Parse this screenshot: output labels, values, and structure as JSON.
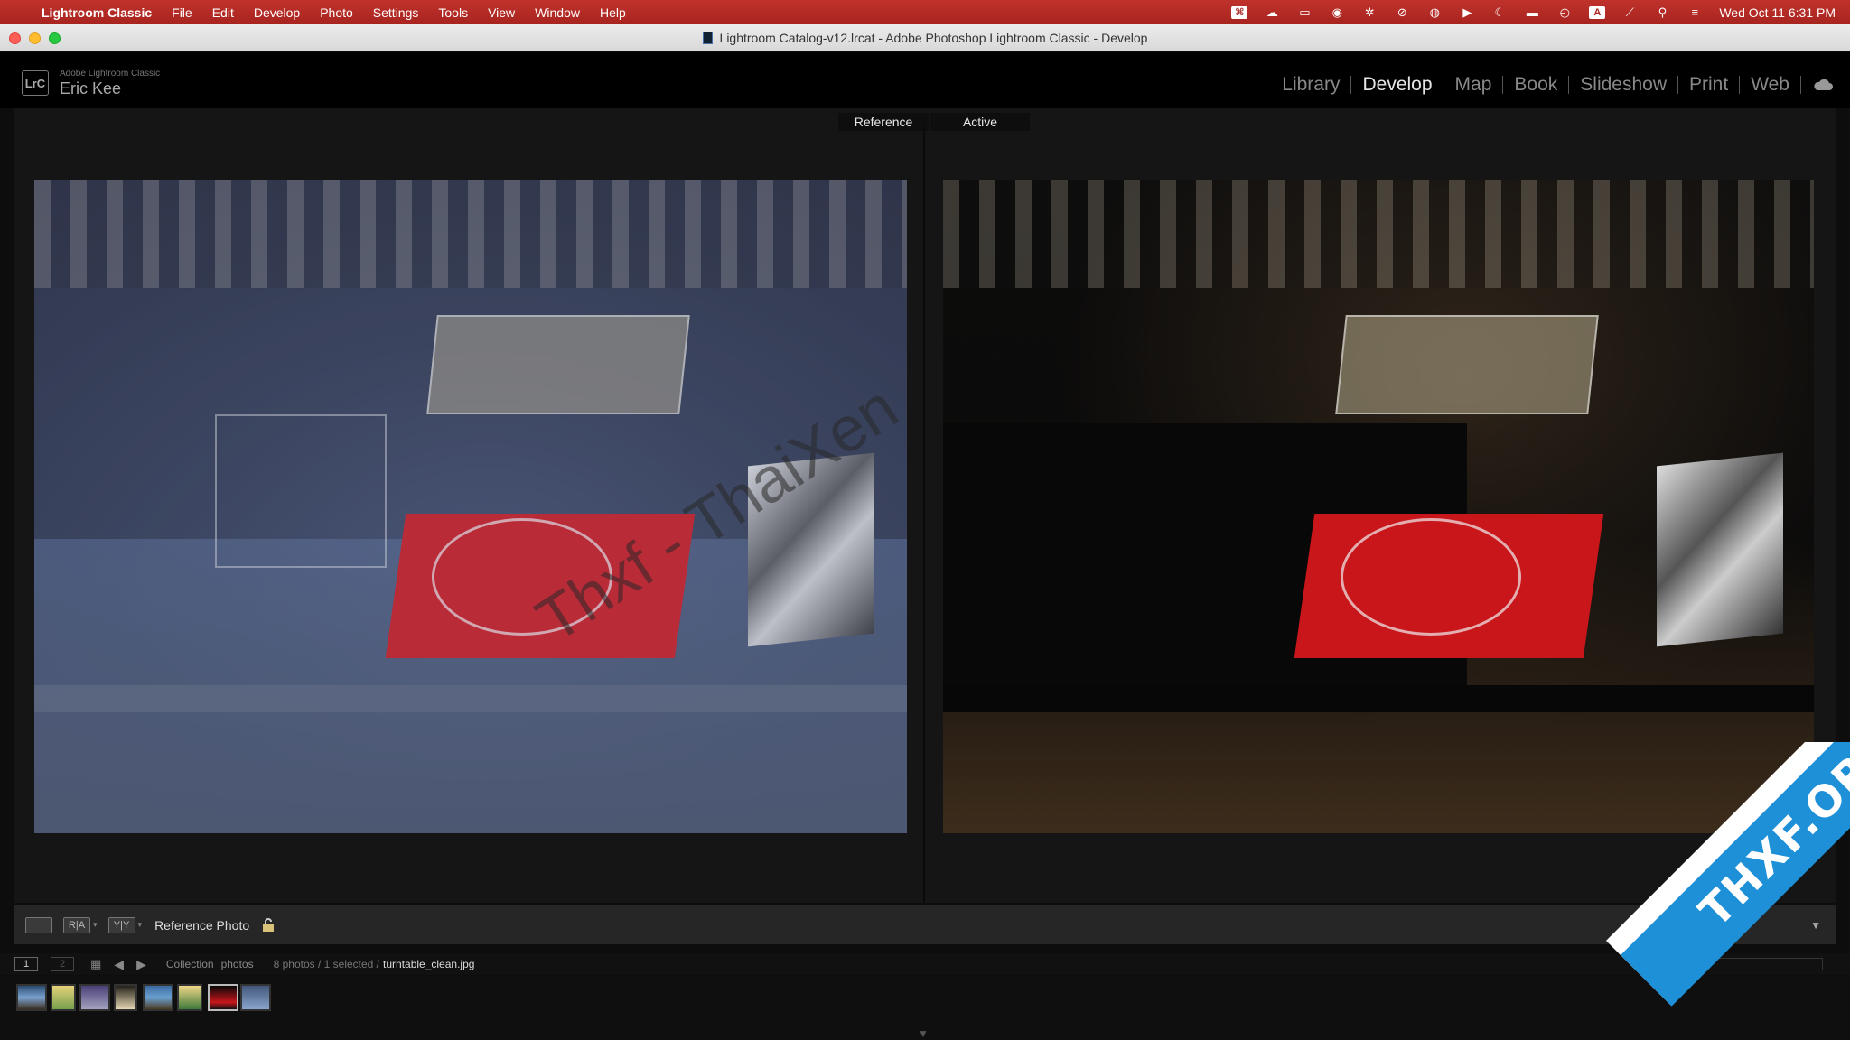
{
  "menubar": {
    "app_name": "Lightroom Classic",
    "items": [
      "File",
      "Edit",
      "Develop",
      "Photo",
      "Settings",
      "Tools",
      "View",
      "Window",
      "Help"
    ],
    "clock": "Wed Oct 11  6:31 PM",
    "status_icons": [
      "keyboard-shortcut-icon",
      "creative-cloud-icon",
      "display-icon",
      "wifi-icon",
      "gear-icon",
      "search-magnifier-icon",
      "vpn-globe-icon",
      "play-icon",
      "moon-icon",
      "battery-icon",
      "time-machine-icon",
      "input-source-icon",
      "bluetooth-icon",
      "spotlight-icon",
      "control-center-icon"
    ],
    "input_source_label": "A"
  },
  "window": {
    "title": "Lightroom Catalog-v12.lrcat - Adobe Photoshop Lightroom Classic - Develop"
  },
  "identity": {
    "badge": "LrC",
    "product": "Adobe Lightroom Classic",
    "user": "Eric Kee"
  },
  "modules": {
    "items": [
      "Library",
      "Develop",
      "Map",
      "Book",
      "Slideshow",
      "Print",
      "Web"
    ],
    "active": "Develop"
  },
  "view": {
    "reference_label": "Reference",
    "active_label": "Active"
  },
  "watermark": "Thxf - ThaiXen",
  "toolbar": {
    "loupe_btn": "",
    "ref_btn": "R|A",
    "compare_btn": "Y|Y",
    "reference_photo_label": "Reference Photo"
  },
  "filmstrip": {
    "page1": "1",
    "page2": "2",
    "source_prefix": "Collection",
    "source_name": "photos",
    "count_text": "8 photos / 1 selected /",
    "filename": "turntable_clean.jpg",
    "thumb_count": 8,
    "selected_index": 7
  },
  "corner_logo": "THXF.ORG",
  "colors": {
    "menubar": "#b22a24",
    "module_active": "#e6e6e6",
    "module_inactive": "#888888",
    "accent_red": "#c8161b"
  }
}
